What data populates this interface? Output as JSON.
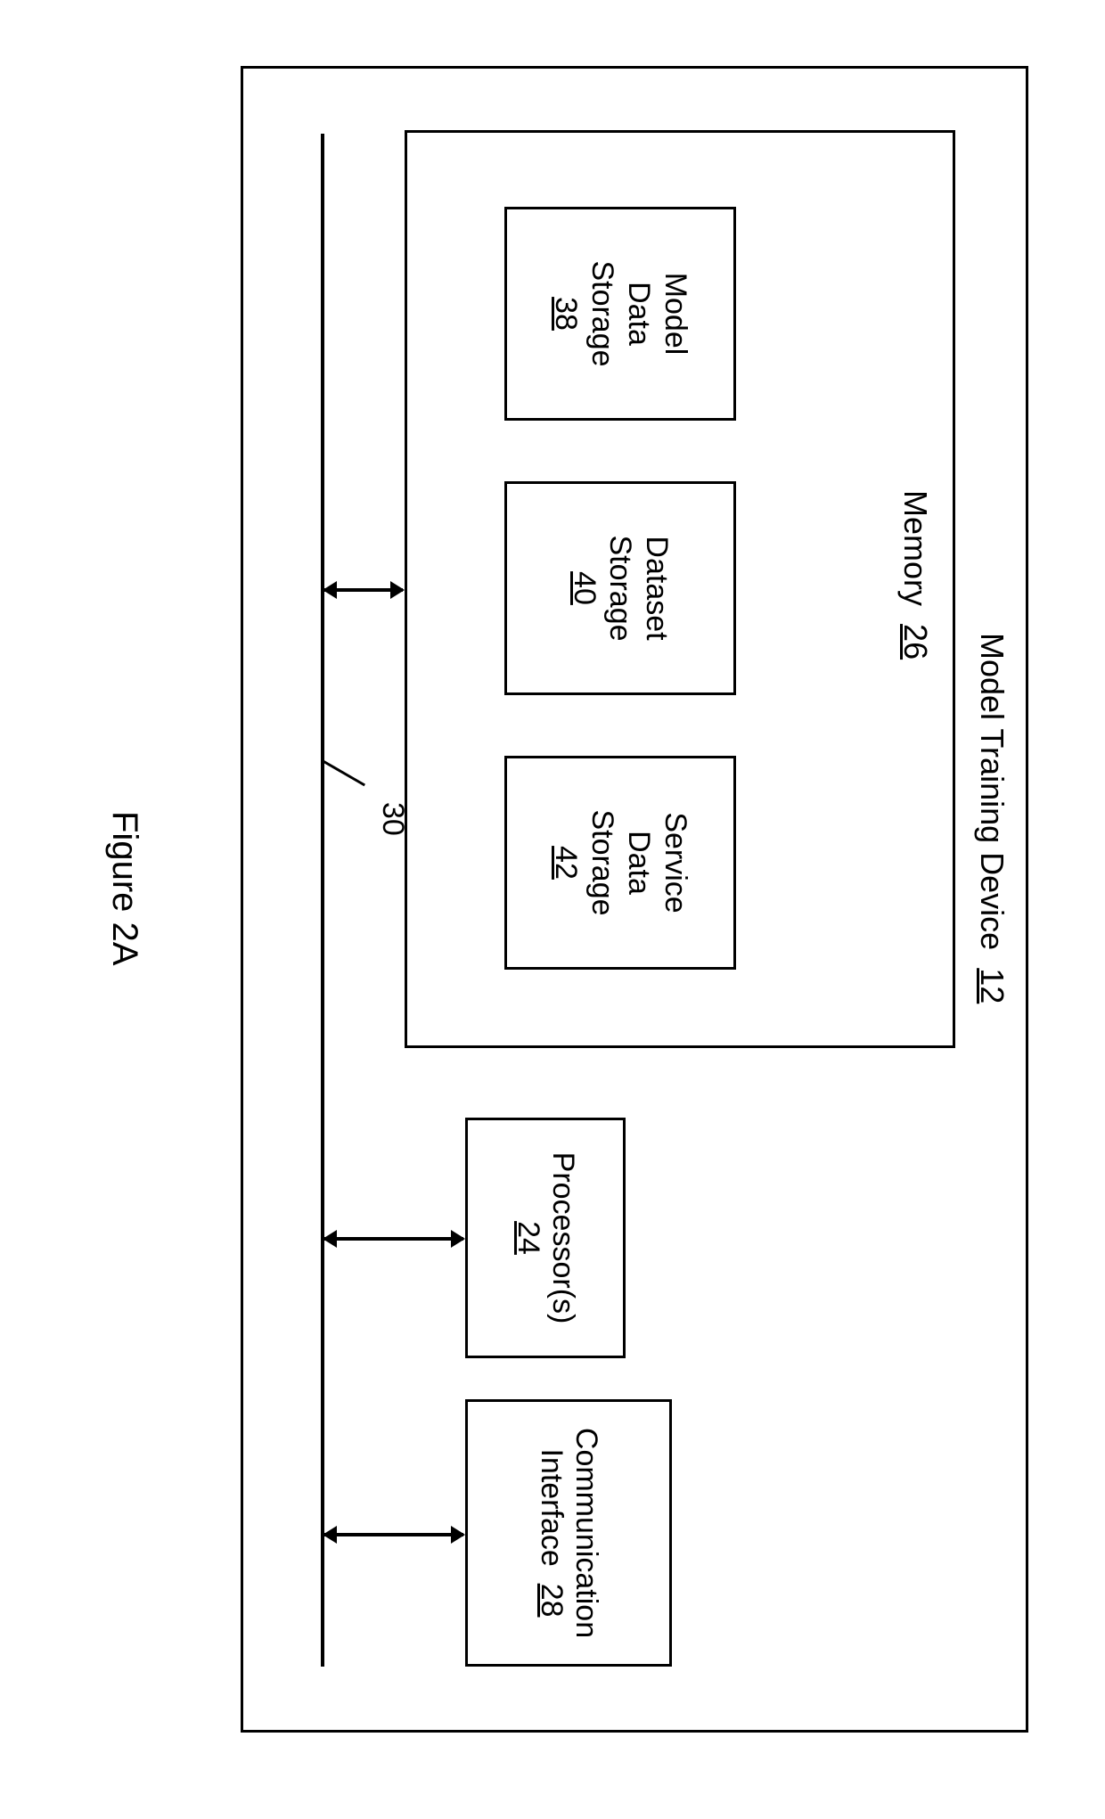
{
  "title": {
    "label": "Model Training Device",
    "ref": "12"
  },
  "memory": {
    "label": "Memory",
    "ref": "26",
    "boxes": {
      "model": {
        "l1": "Model",
        "l2": "Data",
        "l3": "Storage",
        "ref": "38"
      },
      "dataset": {
        "l1": "Dataset",
        "l2": "Storage",
        "ref": "40"
      },
      "service": {
        "l1": "Service",
        "l2": "Data",
        "l3": "Storage",
        "ref": "42"
      }
    }
  },
  "processor": {
    "label": "Processor(s)",
    "ref": "24"
  },
  "comm": {
    "l1": "Communication",
    "l2": "Interface",
    "ref": "28"
  },
  "bus_ref": "30",
  "figure_caption": "Figure 2A"
}
